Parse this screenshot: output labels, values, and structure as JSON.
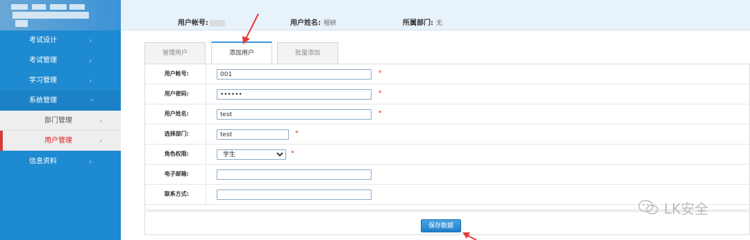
{
  "sidebar": {
    "items": [
      {
        "label": "考试设计"
      },
      {
        "label": "考试管理"
      },
      {
        "label": "学习管理"
      },
      {
        "label": "系统管理"
      },
      {
        "label": "信息资料"
      }
    ],
    "sub_items": [
      {
        "label": "部门管理"
      },
      {
        "label": "用户管理"
      }
    ],
    "chevron_right": "›",
    "chevron_down": "⌄"
  },
  "header": {
    "account_label": "用户帐号:",
    "name_label": "用户姓名:",
    "name_value": "程妍",
    "dept_label": "所属部门:",
    "dept_value": "无"
  },
  "tabs": [
    {
      "label": "管理用户"
    },
    {
      "label": "添加用户"
    },
    {
      "label": "批量添加"
    }
  ],
  "form": {
    "account": {
      "label": "用户帐号:",
      "value": "001"
    },
    "password": {
      "label": "用户密码:",
      "value": "••••••"
    },
    "name": {
      "label": "用户姓名:",
      "value": "test"
    },
    "dept": {
      "label": "选择部门:",
      "value": "test"
    },
    "role": {
      "label": "角色权限:",
      "value": "学生"
    },
    "email": {
      "label": "电子邮箱:",
      "value": ""
    },
    "contact": {
      "label": "联系方式:",
      "value": ""
    },
    "required_mark": "*"
  },
  "save_button": "保存数据",
  "watermark": "LK安全",
  "colors": {
    "sidebar": "#1e8ad1",
    "accent": "#3b93d6",
    "active_red": "#e02020",
    "arrow": "#e23b3b"
  }
}
